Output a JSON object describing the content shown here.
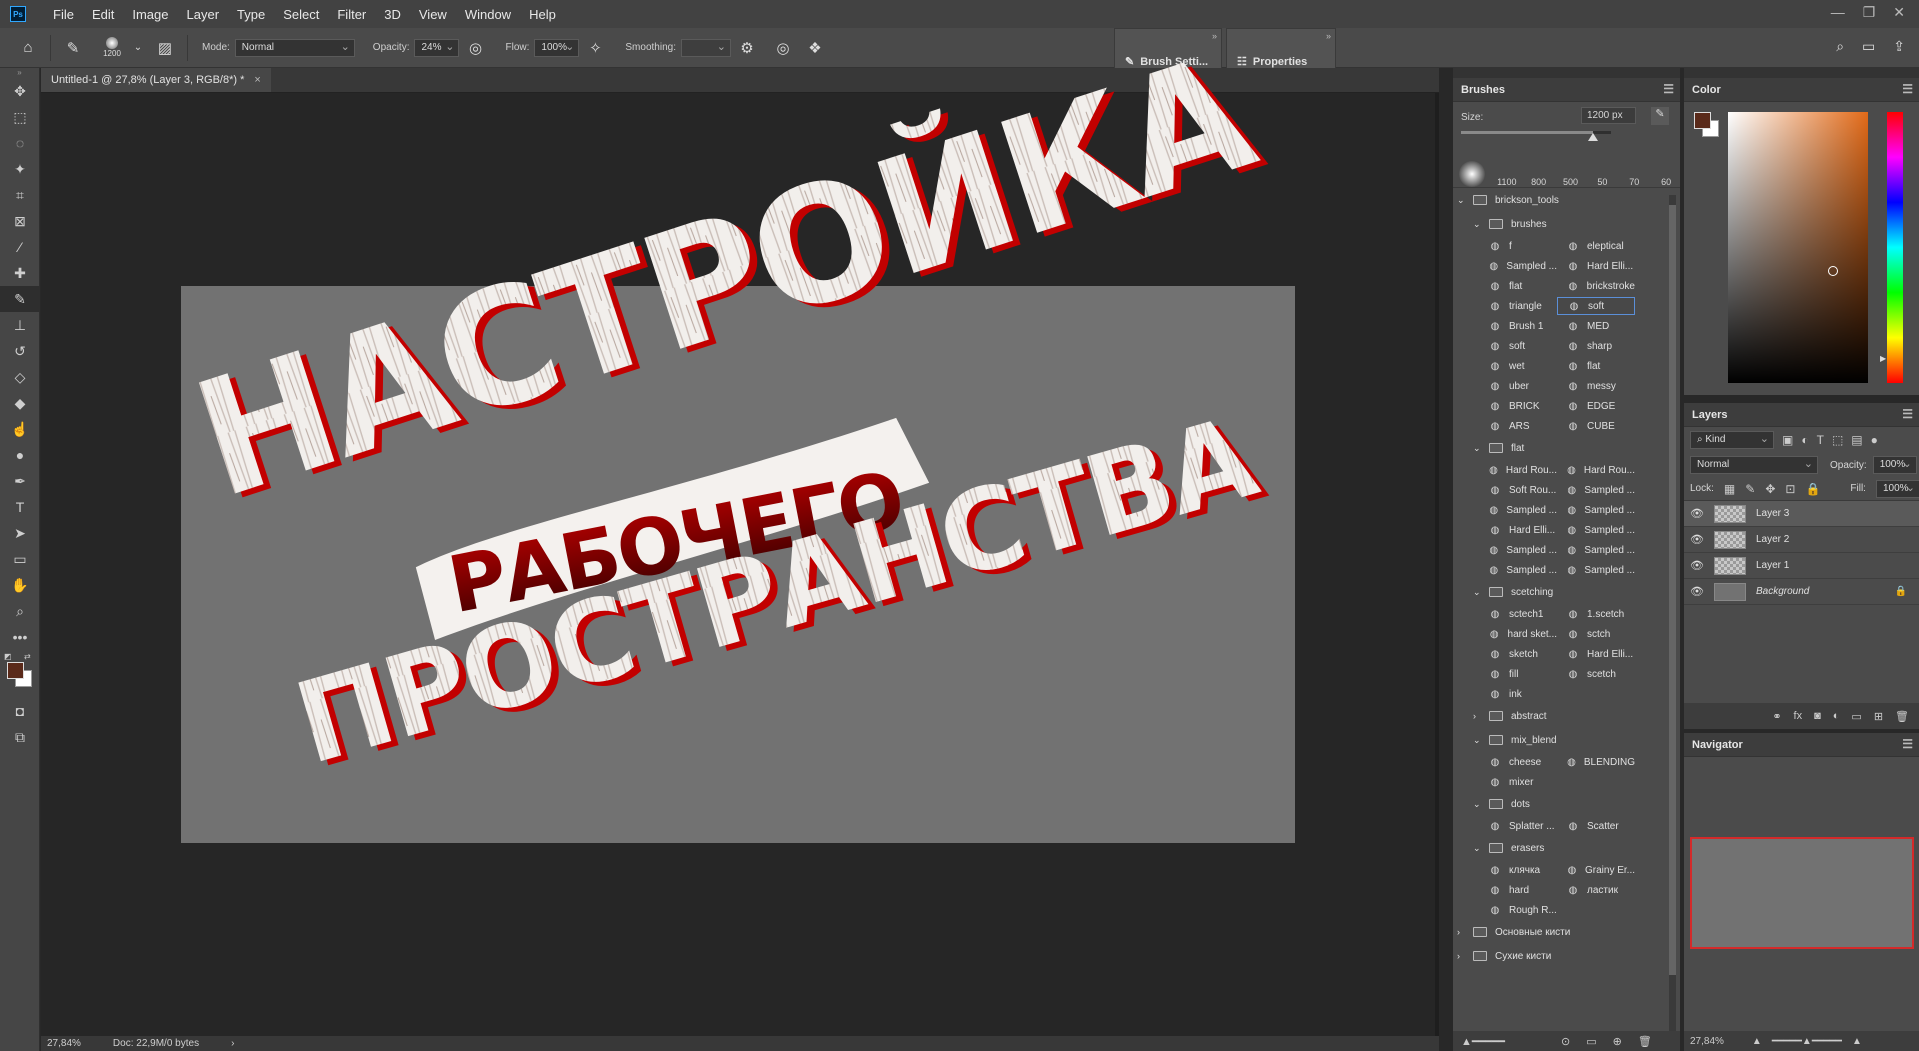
{
  "app": {
    "logo_text": "Ps",
    "menu": [
      "File",
      "Edit",
      "Image",
      "Layer",
      "Type",
      "Select",
      "Filter",
      "3D",
      "View",
      "Window",
      "Help"
    ],
    "window_controls": [
      "—",
      "❐",
      "✕"
    ]
  },
  "options_bar": {
    "brush_size": "1200",
    "mode_label": "Mode:",
    "mode_value": "Normal",
    "opacity_label": "Opacity:",
    "opacity_value": "24%",
    "flow_label": "Flow:",
    "flow_value": "100%",
    "smoothing_label": "Smoothing:",
    "smoothing_value": ""
  },
  "floating_panels": {
    "brush_settings": "Brush Setti...",
    "properties": "Properties"
  },
  "document": {
    "tab_title": "Untitled-1 @ 27,8% (Layer 3, RGB/8*) *",
    "tab_close": "×",
    "text_line1": "НАСТРОЙКА",
    "text_line2": "РАБОЧЕГО",
    "text_line3": "ПРОСТРАНСТВА",
    "zoom_status": "27,84%",
    "doc_status": "Doc: 22,9M/0 bytes"
  },
  "brushes_panel": {
    "title": "Brushes",
    "size_label": "Size:",
    "size_value": "1200 px",
    "size_fill": 0.88,
    "presets": [
      "1100",
      "800",
      "500",
      "50",
      "70",
      "60"
    ],
    "root_folder": "brickson_tools",
    "groups": [
      {
        "name": "brushes",
        "items": [
          [
            "f",
            "eleptical"
          ],
          [
            "Sampled ...",
            "Hard Elli..."
          ],
          [
            "flat",
            "brickstroke"
          ],
          [
            "triangle",
            "soft"
          ],
          [
            "Brush 1",
            "MED"
          ],
          [
            "soft",
            "sharp"
          ],
          [
            "wet",
            "flat"
          ],
          [
            "uber",
            "messy"
          ],
          [
            "BRICK",
            "EDGE"
          ],
          [
            "ARS",
            "CUBE"
          ]
        ]
      },
      {
        "name": "flat",
        "items": [
          [
            "Hard Rou...",
            "Hard Rou..."
          ],
          [
            "Soft Rou...",
            "Sampled ..."
          ],
          [
            "Sampled ...",
            "Sampled ..."
          ],
          [
            "Hard Elli...",
            "Sampled ..."
          ],
          [
            "Sampled ...",
            "Sampled ..."
          ],
          [
            "Sampled ...",
            "Sampled ..."
          ]
        ]
      },
      {
        "name": "scetching",
        "items": [
          [
            "sctech1",
            "1.scetch"
          ],
          [
            "hard sket...",
            "sctch"
          ],
          [
            "sketch",
            "Hard Elli..."
          ],
          [
            "fill",
            "scetch"
          ],
          [
            "ink",
            ""
          ]
        ]
      },
      {
        "name": "abstract",
        "collapsed": true,
        "items": []
      },
      {
        "name": "mix_blend",
        "items": [
          [
            "cheese",
            "BLENDING"
          ],
          [
            "mixer",
            ""
          ]
        ]
      },
      {
        "name": "dots",
        "items": [
          [
            "Splatter ...",
            "Scatter"
          ]
        ]
      },
      {
        "name": "erasers",
        "items": [
          [
            "клячка",
            "Grainy Er..."
          ],
          [
            "hard",
            "ластик"
          ],
          [
            "Rough R...",
            ""
          ]
        ]
      }
    ],
    "bottom_folders": [
      "Основные кисти",
      "Сухие кисти"
    ]
  },
  "color_panel": {
    "title": "Color",
    "foreground": "#5a2a1a",
    "background": "#ffffff",
    "hue": "#e26a18"
  },
  "layers_panel": {
    "title": "Layers",
    "filter_kind": "Kind",
    "blend_mode": "Normal",
    "opacity_label": "Opacity:",
    "opacity_value": "100%",
    "lock_label": "Lock:",
    "fill_label": "Fill:",
    "fill_value": "100%",
    "layers": [
      {
        "name": "Layer 3",
        "active": true
      },
      {
        "name": "Layer 2",
        "active": false
      },
      {
        "name": "Layer 1",
        "active": false
      },
      {
        "name": "Background",
        "active": false,
        "locked": true
      }
    ]
  },
  "navigator_panel": {
    "title": "Navigator",
    "zoom": "27,84%"
  }
}
